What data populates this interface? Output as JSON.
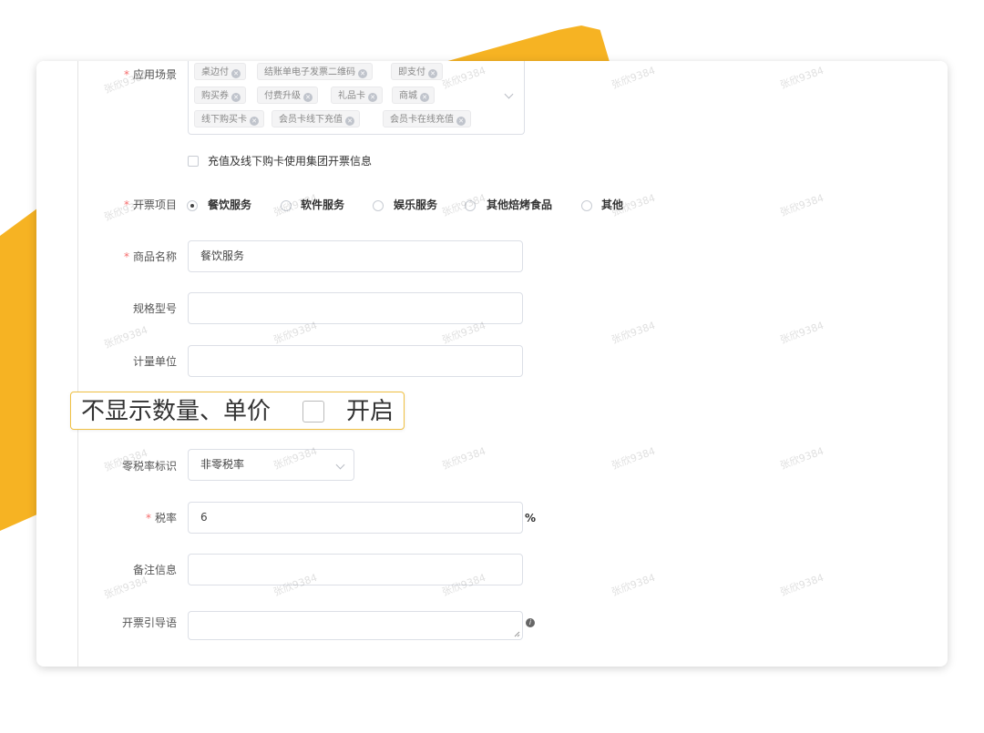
{
  "form": {
    "scene": {
      "label": "应用场景",
      "tags": [
        "桌边付",
        "结账单电子发票二维码",
        "即支付",
        "购买券",
        "付费升级",
        "礼品卡",
        "商城",
        "线下购买卡",
        "会员卡线下充值",
        "会员卡在线充值"
      ]
    },
    "recharge_checkbox_label": "充值及线下购卡使用集团开票信息",
    "invoice_item": {
      "label": "开票项目",
      "options": [
        "餐饮服务",
        "软件服务",
        "娱乐服务",
        "其他焙烤食品",
        "其他"
      ],
      "selected": "餐饮服务"
    },
    "product_name": {
      "label": "商品名称",
      "value": "餐饮服务"
    },
    "spec_model": {
      "label": "规格型号",
      "value": ""
    },
    "unit": {
      "label": "计量单位",
      "value": ""
    },
    "hide_qty": {
      "label": "不显示数量、单价",
      "option": "开启"
    },
    "zero_tax": {
      "label": "零税率标识",
      "value": "非零税率"
    },
    "tax_rate": {
      "label": "税率",
      "value": "6",
      "suffix": "%"
    },
    "remark": {
      "label": "备注信息",
      "value": ""
    },
    "guide": {
      "label": "开票引导语",
      "value": ""
    },
    "watermark": "张欣9384",
    "colors": {
      "accent": "#f6b323",
      "required": "#f56c6c"
    }
  }
}
